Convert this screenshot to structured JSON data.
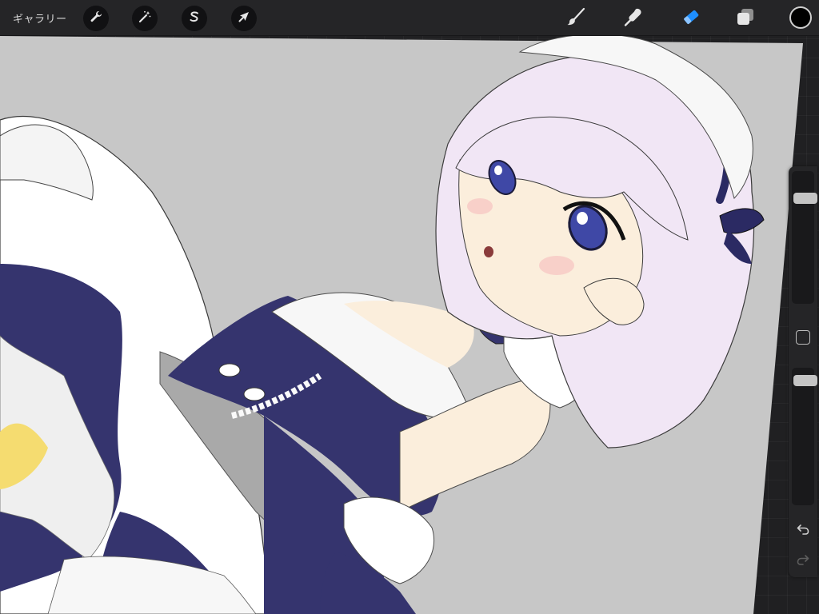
{
  "app": {
    "gallery_label": "ギャラリー"
  },
  "toolbar": {
    "left_tools": [
      {
        "name": "actions",
        "icon": "wrench-icon"
      },
      {
        "name": "adjustments",
        "icon": "magic-wand-icon"
      },
      {
        "name": "selection",
        "icon": "selection-s-icon"
      },
      {
        "name": "transform",
        "icon": "arrow-cursor-icon"
      }
    ],
    "right_tools": [
      {
        "name": "brush",
        "icon": "brush-icon",
        "active": false
      },
      {
        "name": "smudge",
        "icon": "smudge-finger-icon",
        "active": false
      },
      {
        "name": "eraser",
        "icon": "eraser-icon",
        "active": true
      },
      {
        "name": "layers",
        "icon": "layers-icon",
        "active": false
      }
    ],
    "current_color": "#000000",
    "active_tool_color": "#1e8fff"
  },
  "sidebar": {
    "brush_size_level": 0.82,
    "opacity_level": 0.06,
    "undo_icon": "undo-arrow-icon",
    "redo_icon": "redo-arrow-icon"
  },
  "canvas": {
    "background_color": "#c7c7c7",
    "hair_color": "#f1e6f5",
    "dress_color": "#35346e",
    "apron_color": "#f7f7f7",
    "skin_color": "#fbeedc",
    "eye_color": "#3f48a6"
  }
}
